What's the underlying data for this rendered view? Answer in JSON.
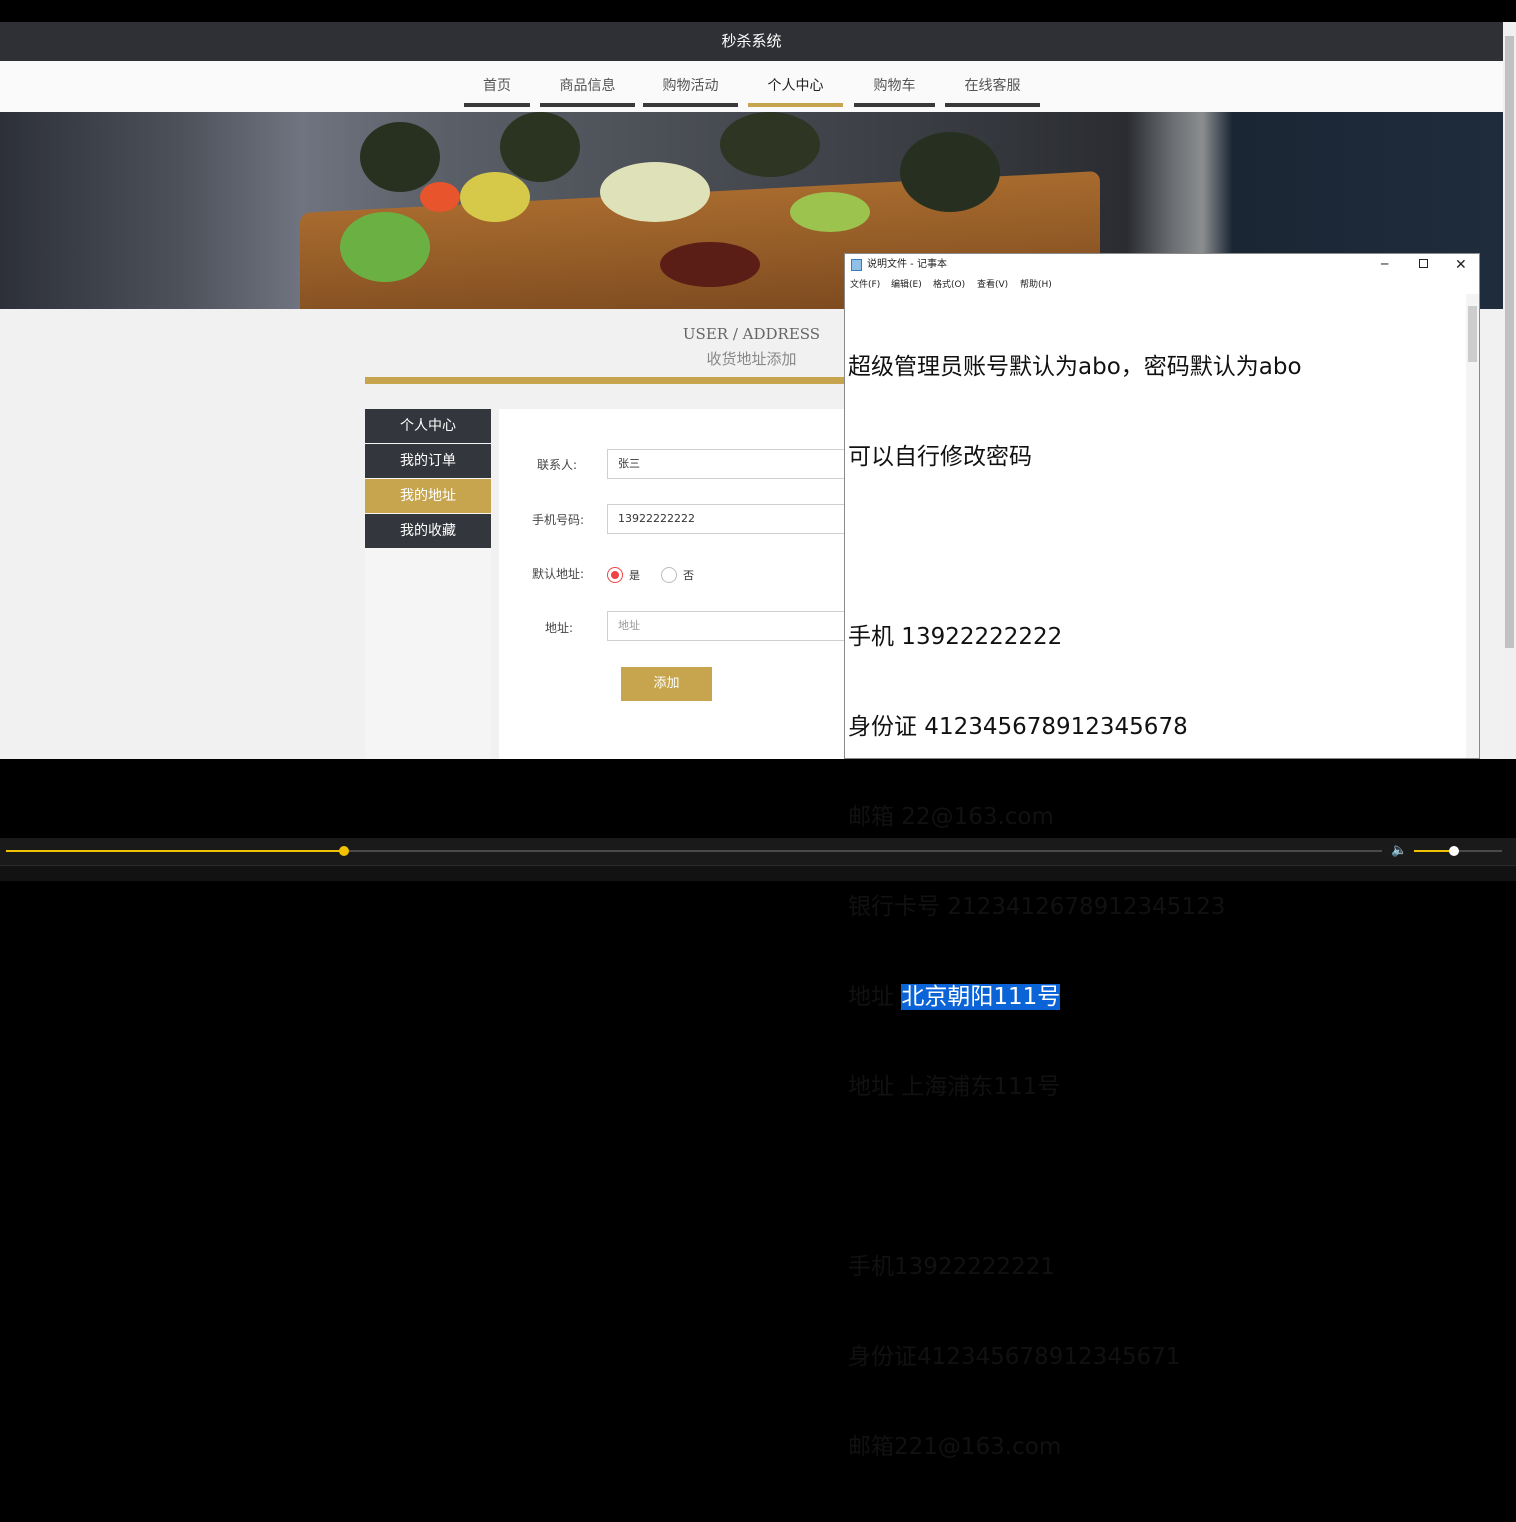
{
  "site": {
    "title": "秒杀系统",
    "nav": [
      "首页",
      "商品信息",
      "购物活动",
      "个人中心",
      "购物车",
      "在线客服"
    ],
    "active_nav": "个人中心"
  },
  "section": {
    "en": "USER / ADDRESS",
    "cn": "收货地址添加"
  },
  "sidebar": {
    "items": [
      "个人中心",
      "我的订单",
      "我的地址",
      "我的收藏"
    ],
    "active": "我的地址"
  },
  "form": {
    "contact_label": "联系人:",
    "contact_value": "张三",
    "phone_label": "手机号码:",
    "phone_value": "13922222222",
    "default_label": "默认地址:",
    "yes_label": "是",
    "no_label": "否",
    "default_selected": "是",
    "address_label": "地址:",
    "address_placeholder": "地址",
    "submit_label": "添加"
  },
  "notepad": {
    "title": "说明文件 - 记事本",
    "menu": [
      "文件(F)",
      "编辑(E)",
      "格式(O)",
      "查看(V)",
      "帮助(H)"
    ],
    "lines": [
      "超级管理员账号默认为abo，密码默认为abo",
      "可以自行修改密码",
      "",
      "手机 13922222222",
      "身份证 412345678912345678",
      "邮箱 22@163.com",
      "银行卡号 212341267891234512​3",
      "地址 北京朝阳111号",
      "地址 上海浦东111号",
      "",
      "手机13922222221",
      "身份证412345678912345671",
      "邮箱221@163.com"
    ],
    "selected_prefix": "地址 ",
    "selected_text": "北京朝阳111号"
  },
  "player": {
    "progress": 0.246,
    "volume": 0.45,
    "colors": {
      "accent": "#f2c200",
      "track": "#4a4a4a"
    }
  }
}
